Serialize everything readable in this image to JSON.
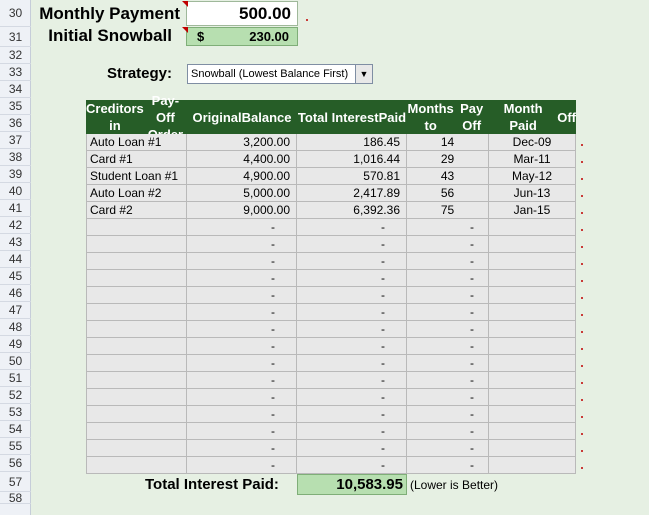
{
  "row_numbers": [
    "30",
    "31",
    "32",
    "33",
    "34",
    "35",
    "36",
    "37",
    "38",
    "39",
    "40",
    "41",
    "42",
    "43",
    "44",
    "45",
    "46",
    "47",
    "48",
    "49",
    "50",
    "51",
    "52",
    "53",
    "54",
    "55",
    "56",
    "57",
    "58"
  ],
  "monthly_payment": {
    "label": "Monthly Payment",
    "value": "500.00"
  },
  "initial_snowball": {
    "label": "Initial Snowball",
    "currency": "$",
    "value": "230.00"
  },
  "strategy": {
    "label": "Strategy:",
    "selected": "Snowball (Lowest Balance First)",
    "arrow_icon": "▼"
  },
  "table": {
    "headers": [
      "Creditors in Pay-Off Order",
      "Original Balance",
      "Total Interest Paid",
      "Months to Pay Off",
      "Month Paid Off"
    ],
    "rows": [
      {
        "creditor": "Auto Loan #1",
        "balance": "3,200.00",
        "interest": "186.45",
        "months": "14",
        "paid_off": "Dec-09"
      },
      {
        "creditor": "Card #1",
        "balance": "4,400.00",
        "interest": "1,016.44",
        "months": "29",
        "paid_off": "Mar-11"
      },
      {
        "creditor": "Student Loan #1",
        "balance": "4,900.00",
        "interest": "570.81",
        "months": "43",
        "paid_off": "May-12"
      },
      {
        "creditor": "Auto Loan #2",
        "balance": "5,000.00",
        "interest": "2,417.89",
        "months": "56",
        "paid_off": "Jun-13"
      },
      {
        "creditor": "Card #2",
        "balance": "9,000.00",
        "interest": "6,392.36",
        "months": "75",
        "paid_off": "Jan-15"
      }
    ],
    "empty_row_count": 15,
    "dash": "-"
  },
  "total": {
    "label": "Total Interest Paid:",
    "value": "10,583.95",
    "note": "(Lower is Better)"
  },
  "colors": {
    "header_green": "#265d27",
    "highlight_green": "#b7dfb0",
    "background": "#e6f0e3",
    "comment_marker": "#c00000"
  }
}
